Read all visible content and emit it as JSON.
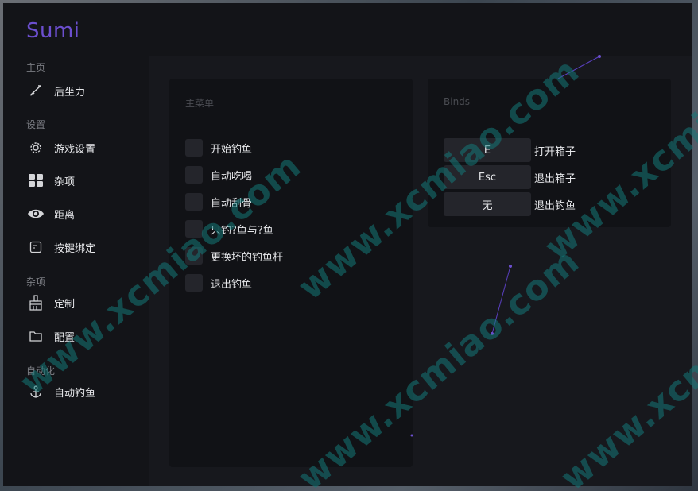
{
  "app": {
    "brand": "Sumi"
  },
  "sidebar": {
    "sections": [
      {
        "title": "主页"
      },
      {
        "title": "设置"
      },
      {
        "title": "杂项"
      },
      {
        "title": "自动化"
      }
    ],
    "items": [
      {
        "label": "后坐力",
        "icon": "rifle-icon"
      },
      {
        "label": "游戏设置",
        "icon": "gear-icon"
      },
      {
        "label": "杂项",
        "icon": "grid-icon"
      },
      {
        "label": "距离",
        "icon": "eye-icon"
      },
      {
        "label": "按键绑定",
        "icon": "keyboard-key-icon"
      },
      {
        "label": "定制",
        "icon": "paint-brush-icon"
      },
      {
        "label": "配置",
        "icon": "folder-icon"
      },
      {
        "label": "自动钓鱼",
        "icon": "anchor-icon"
      }
    ]
  },
  "main_panel": {
    "title": "主菜单",
    "options": [
      {
        "label": "开始钓鱼",
        "checked": false
      },
      {
        "label": "自动吃喝",
        "checked": false
      },
      {
        "label": "自动刮骨",
        "checked": false
      },
      {
        "label": "只钓?鱼与?鱼",
        "checked": false
      },
      {
        "label": "更换坏的钓鱼杆",
        "checked": false
      },
      {
        "label": "退出钓鱼",
        "checked": false
      }
    ]
  },
  "binds_panel": {
    "title": "Binds",
    "binds": [
      {
        "key": "E",
        "label": "打开箱子"
      },
      {
        "key": "Esc",
        "label": "退出箱子"
      },
      {
        "key": "无",
        "label": "退出钓鱼"
      }
    ]
  },
  "watermark": {
    "text": "www.xcmiao.com"
  },
  "colors": {
    "accent": "#6c4fcf",
    "background": "#131418",
    "panel": "#111216",
    "control": "#24252b"
  }
}
